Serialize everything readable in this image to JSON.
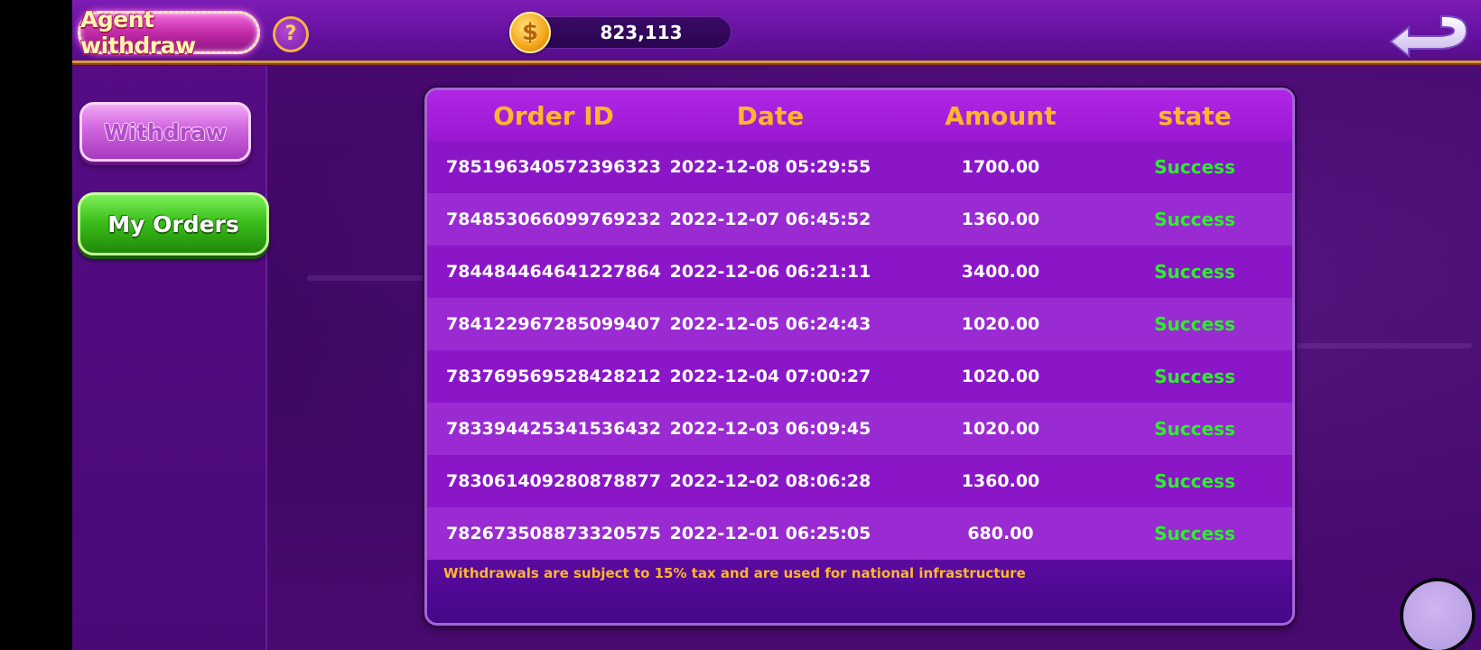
{
  "header": {
    "title": "Agent withdraw",
    "help_icon_glyph": "?",
    "coin_glyph": "$",
    "balance": "823,113",
    "back_icon": "back-arrow-icon"
  },
  "sidebar": {
    "withdraw_label": "Withdraw",
    "my_orders_label": "My Orders"
  },
  "orders": {
    "columns": [
      "Order ID",
      "Date",
      "Amount",
      "state"
    ],
    "rows": [
      {
        "order_id": "785196340572396323",
        "date": "2022-12-08 05:29:55",
        "amount": "1700.00",
        "state": "Success"
      },
      {
        "order_id": "784853066099769232",
        "date": "2022-12-07 06:45:52",
        "amount": "1360.00",
        "state": "Success"
      },
      {
        "order_id": "784484464641227864",
        "date": "2022-12-06 06:21:11",
        "amount": "3400.00",
        "state": "Success"
      },
      {
        "order_id": "784122967285099407",
        "date": "2022-12-05 06:24:43",
        "amount": "1020.00",
        "state": "Success"
      },
      {
        "order_id": "783769569528428212",
        "date": "2022-12-04 07:00:27",
        "amount": "1020.00",
        "state": "Success"
      },
      {
        "order_id": "783394425341536432",
        "date": "2022-12-03 06:09:45",
        "amount": "1020.00",
        "state": "Success"
      },
      {
        "order_id": "783061409280878877",
        "date": "2022-12-02 08:06:28",
        "amount": "1360.00",
        "state": "Success"
      },
      {
        "order_id": "782673508873320575",
        "date": "2022-12-01 06:25:05",
        "amount": "680.00",
        "state": "Success"
      }
    ],
    "footer_note": "Withdrawals are subject to 15% tax and are used for national infrastructure"
  },
  "colors": {
    "header_text": "#ffb52e",
    "success": "#2cf02a",
    "accent_green": "#3cc01c",
    "accent_pink": "#d36ae0"
  }
}
